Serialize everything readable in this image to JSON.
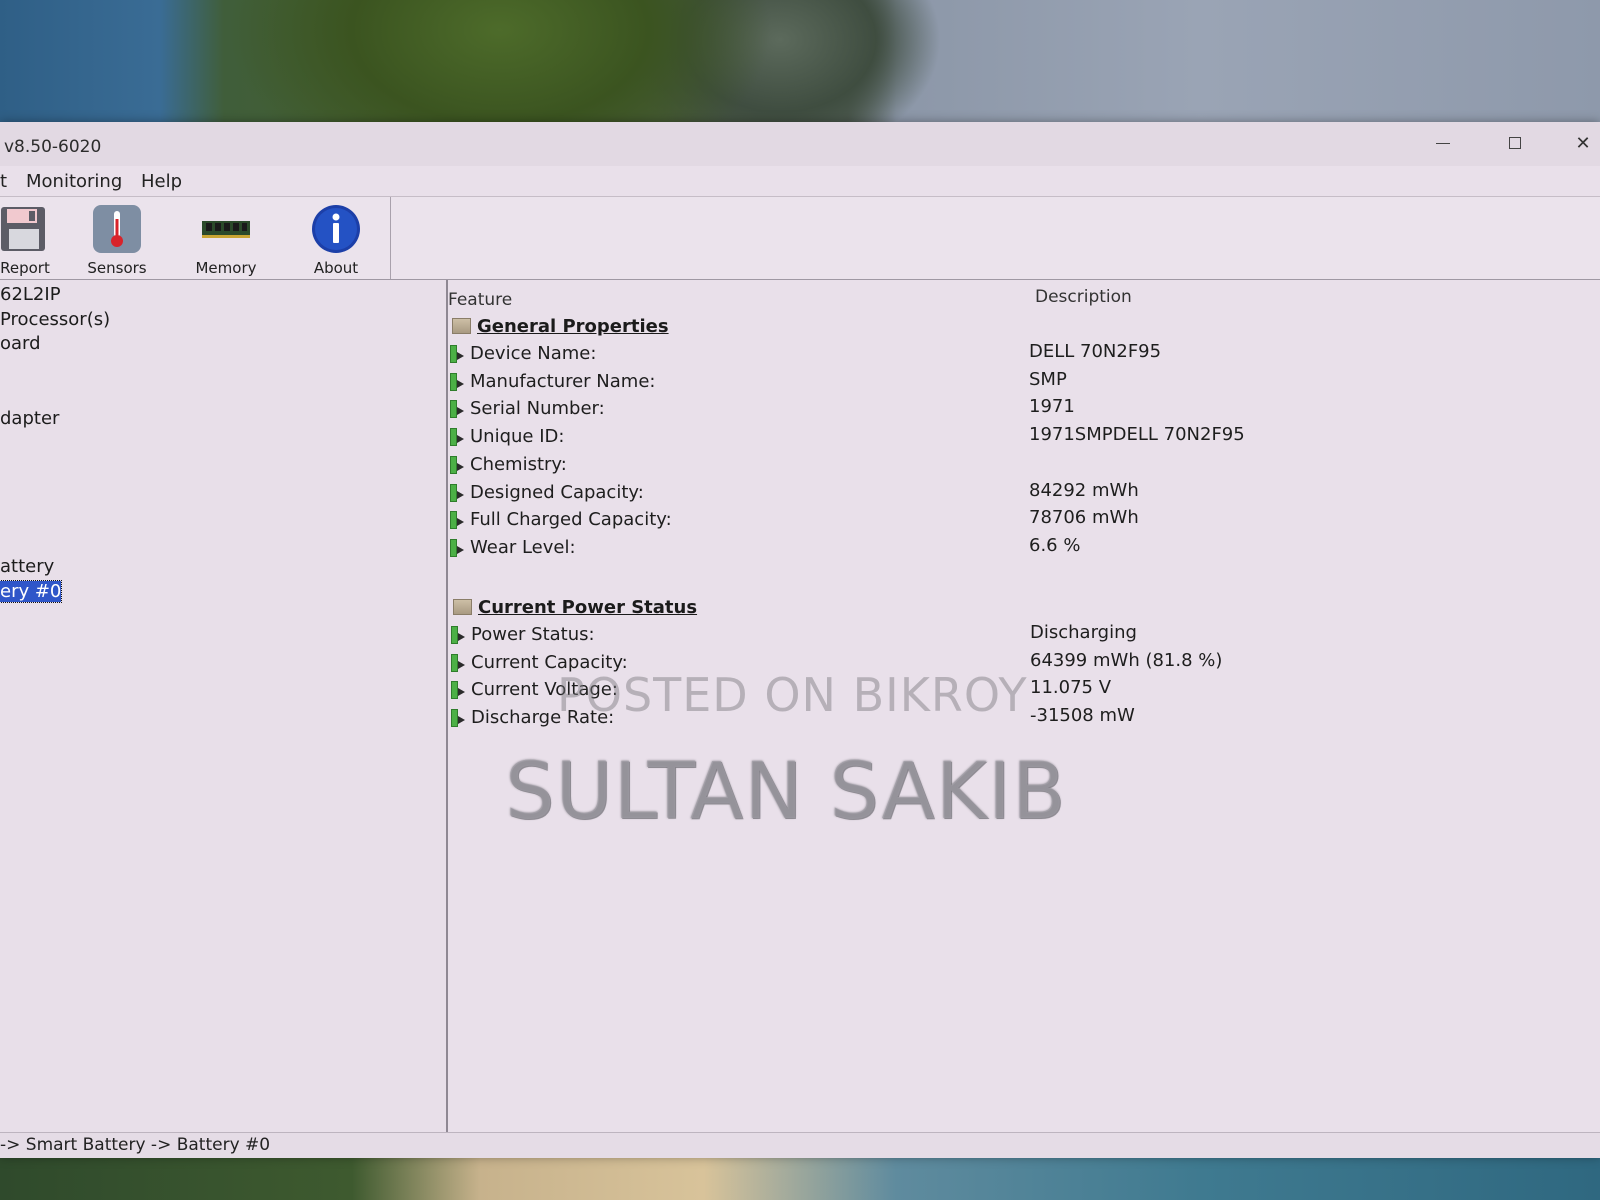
{
  "window": {
    "title": "v8.50-6020"
  },
  "menu": [
    "t",
    "Monitoring",
    "Help"
  ],
  "toolbar": {
    "report": "Report",
    "sensors": "Sensors",
    "memory": "Memory",
    "about": "About"
  },
  "tree": {
    "items": [
      "62L2IP",
      "Processor(s)",
      "oard",
      "dapter",
      "attery",
      "ery #0"
    ],
    "selected_index": 5
  },
  "details": {
    "col_feature": "Feature",
    "col_description": "Description",
    "general_title": "General Properties",
    "general": [
      {
        "name": "Device Name:",
        "value": "DELL 70N2F95"
      },
      {
        "name": "Manufacturer Name:",
        "value": "SMP"
      },
      {
        "name": "Serial Number:",
        "value": "1971"
      },
      {
        "name": "Unique ID:",
        "value": "1971SMPDELL 70N2F95"
      },
      {
        "name": "Chemistry:",
        "value": ""
      },
      {
        "name": "Designed Capacity:",
        "value": "84292 mWh"
      },
      {
        "name": "Full Charged Capacity:",
        "value": "78706 mWh"
      },
      {
        "name": "Wear Level:",
        "value": "6.6 %"
      }
    ],
    "power_title": "Current Power Status",
    "power": [
      {
        "name": "Power Status:",
        "value": "Discharging"
      },
      {
        "name": "Current Capacity:",
        "value": "64399 mWh (81.8 %)"
      },
      {
        "name": "Current Voltage:",
        "value": "11.075 V"
      },
      {
        "name": "Discharge Rate:",
        "value": "-31508 mW"
      }
    ]
  },
  "statusbar": {
    "path": "-> Smart Battery -> Battery #0"
  },
  "watermark": {
    "line1": "POSTED ON BIKROY",
    "line2": "SULTAN SAKIB"
  },
  "colors": {
    "selection": "#2f56c9",
    "window_bg": "#e9e0ea",
    "battery_icon": "#3f9a3a"
  }
}
